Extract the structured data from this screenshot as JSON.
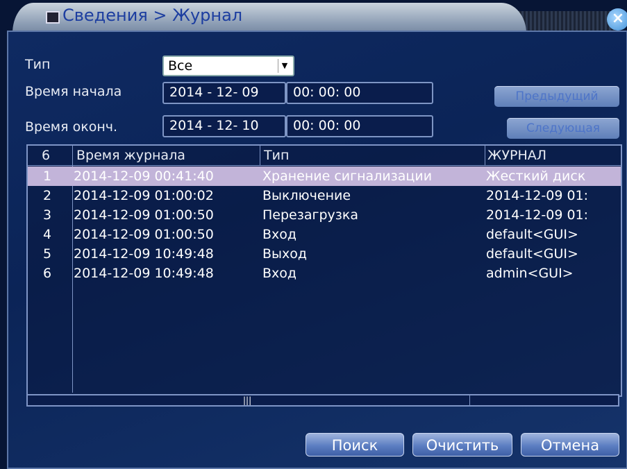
{
  "window": {
    "title": "Сведения > Журнал",
    "close_symbol": "×"
  },
  "filters": {
    "type_label": "Тип",
    "type_value": "Все",
    "start_label": "Время начала",
    "start_date": "2014 - 12- 09",
    "start_time": "00: 00: 00",
    "end_label": "Время оконч.",
    "end_date": "2014 - 12- 10",
    "end_time": "00: 00: 00"
  },
  "nav": {
    "prev_label": "Предыдущий",
    "next_label": "Следующая"
  },
  "table": {
    "count": "6",
    "columns": [
      "Время журнала",
      "Тип",
      "ЖУРНАЛ"
    ],
    "rows": [
      {
        "n": "1",
        "time": "2014-12-09 00:41:40",
        "type": "Хранение сигнализации",
        "log": "Жесткий диск",
        "selected": true
      },
      {
        "n": "2",
        "time": "2014-12-09 01:00:02",
        "type": "Выключение",
        "log": "2014-12-09 01:"
      },
      {
        "n": "3",
        "time": "2014-12-09 01:00:50",
        "type": "Перезагрузка",
        "log": "2014-12-09 01:"
      },
      {
        "n": "4",
        "time": "2014-12-09 01:00:50",
        "type": "Вход",
        "log": "default<GUI>"
      },
      {
        "n": "5",
        "time": "2014-12-09 10:49:48",
        "type": "Выход",
        "log": "default<GUI>"
      },
      {
        "n": "6",
        "time": "2014-12-09 10:49:48",
        "type": "Вход",
        "log": "admin<GUI>"
      }
    ]
  },
  "scrollbar": {
    "grip": "|||"
  },
  "actions": {
    "search_label": "Поиск",
    "clear_label": "Очистить",
    "cancel_label": "Отмена"
  },
  "colors": {
    "selected_row": "#c2b4d9",
    "title_text": "#1d3ea0"
  }
}
